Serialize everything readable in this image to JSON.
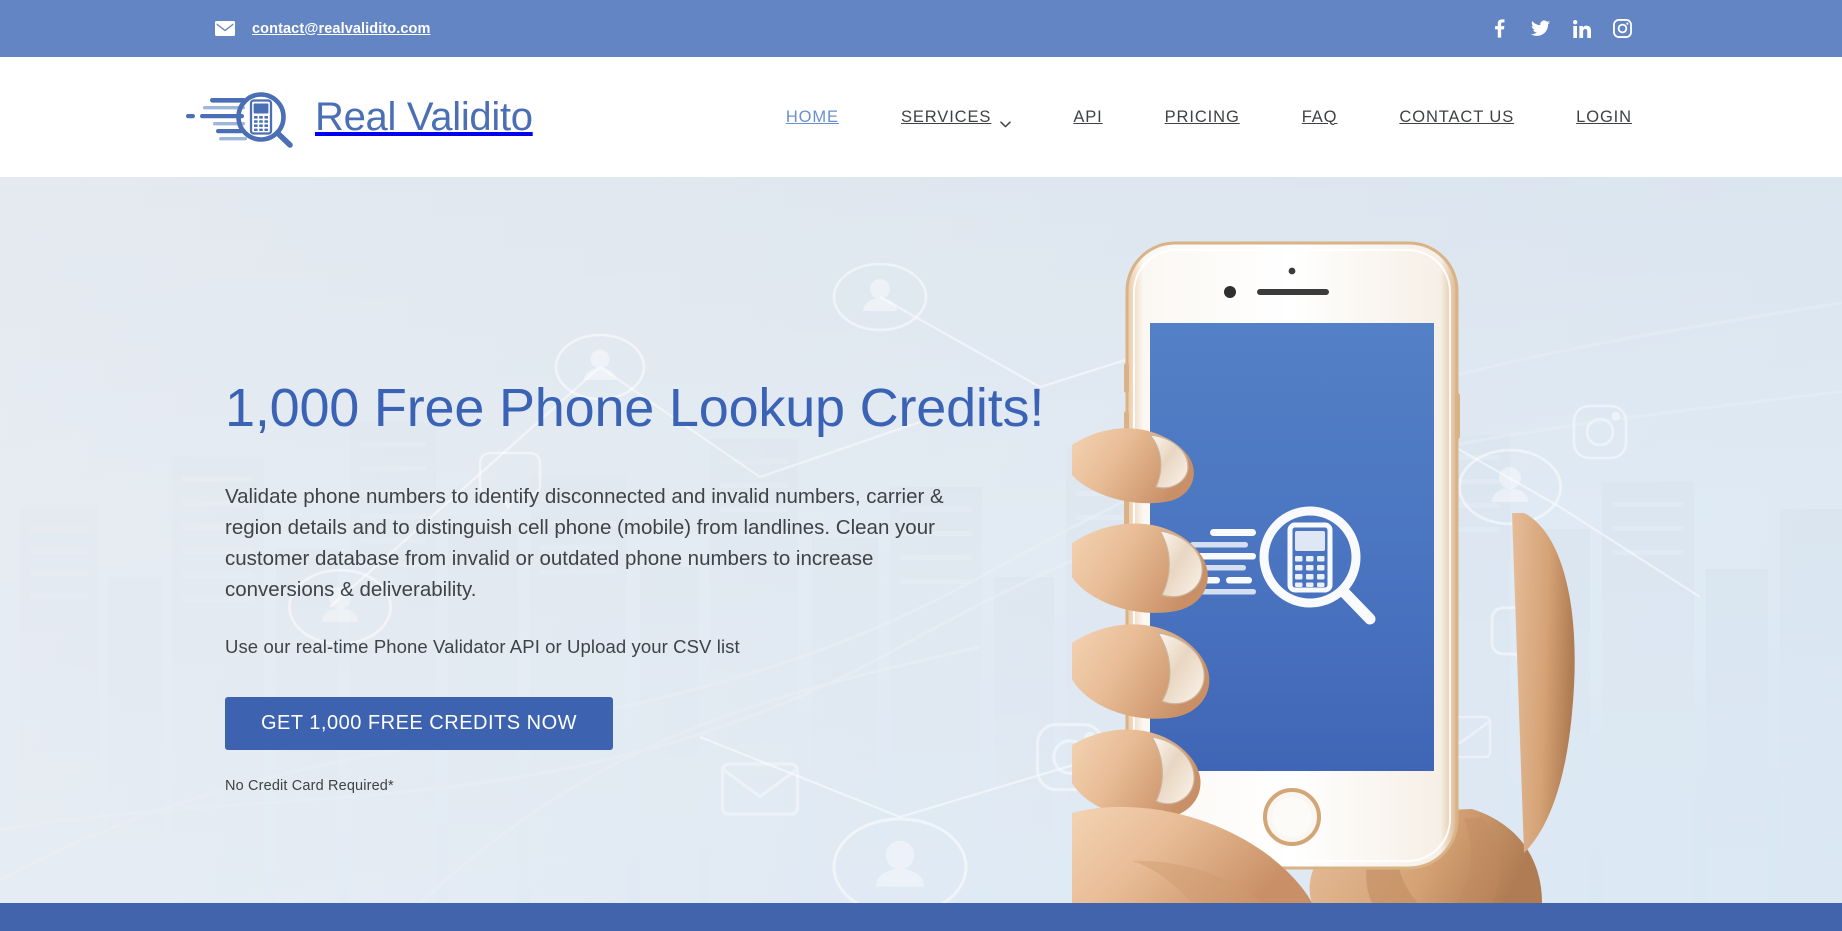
{
  "topbar": {
    "mail_icon": "envelope-icon",
    "email": "contact@realvalidito.com",
    "social": [
      {
        "name": "facebook-icon",
        "label": "Facebook"
      },
      {
        "name": "twitter-icon",
        "label": "Twitter"
      },
      {
        "name": "linkedin-icon",
        "label": "LinkedIn"
      },
      {
        "name": "instagram-icon",
        "label": "Instagram"
      }
    ],
    "bg_color": "#6485c4"
  },
  "header": {
    "logo": {
      "icon": "magnifier-phone-logo-icon",
      "text": "Real Validito",
      "color": "#4a6fb5"
    },
    "nav": [
      {
        "label": "HOME",
        "active": true,
        "has_caret": false
      },
      {
        "label": "SERVICES",
        "active": false,
        "has_caret": true
      },
      {
        "label": "API",
        "active": false,
        "has_caret": false
      },
      {
        "label": "PRICING",
        "active": false,
        "has_caret": false
      },
      {
        "label": "FAQ",
        "active": false,
        "has_caret": false
      },
      {
        "label": "CONTACT US",
        "active": false,
        "has_caret": false
      },
      {
        "label": "LOGIN",
        "active": false,
        "has_caret": false
      }
    ],
    "active_color": "#6a8fd0",
    "text_color": "#3f4245"
  },
  "hero": {
    "title": "1,000 Free Phone Lookup Credits!",
    "title_color": "#3a62b5",
    "paragraph": "Validate phone numbers to identify disconnected and invalid numbers, carrier & region details and to distinguish cell phone (mobile) from landlines. Clean your customer database from invalid or outdated phone numbers to increase conversions & deliverability.",
    "subline": "Use our real-time Phone Validator API or Upload your CSV list",
    "cta_label": "GET 1,000 FREE CREDITS NOW",
    "cta_color": "#3c62b0",
    "cta_note": "No Credit Card Required*",
    "phone_mockup": {
      "name": "hand-holding-phone-image",
      "screen_logo_icon": "magnifier-phone-logo-white-icon",
      "screen_color": "#4a74c0",
      "frame_color": "#f3f1ee"
    }
  },
  "footer": {
    "bg_color": "#4164ad"
  }
}
